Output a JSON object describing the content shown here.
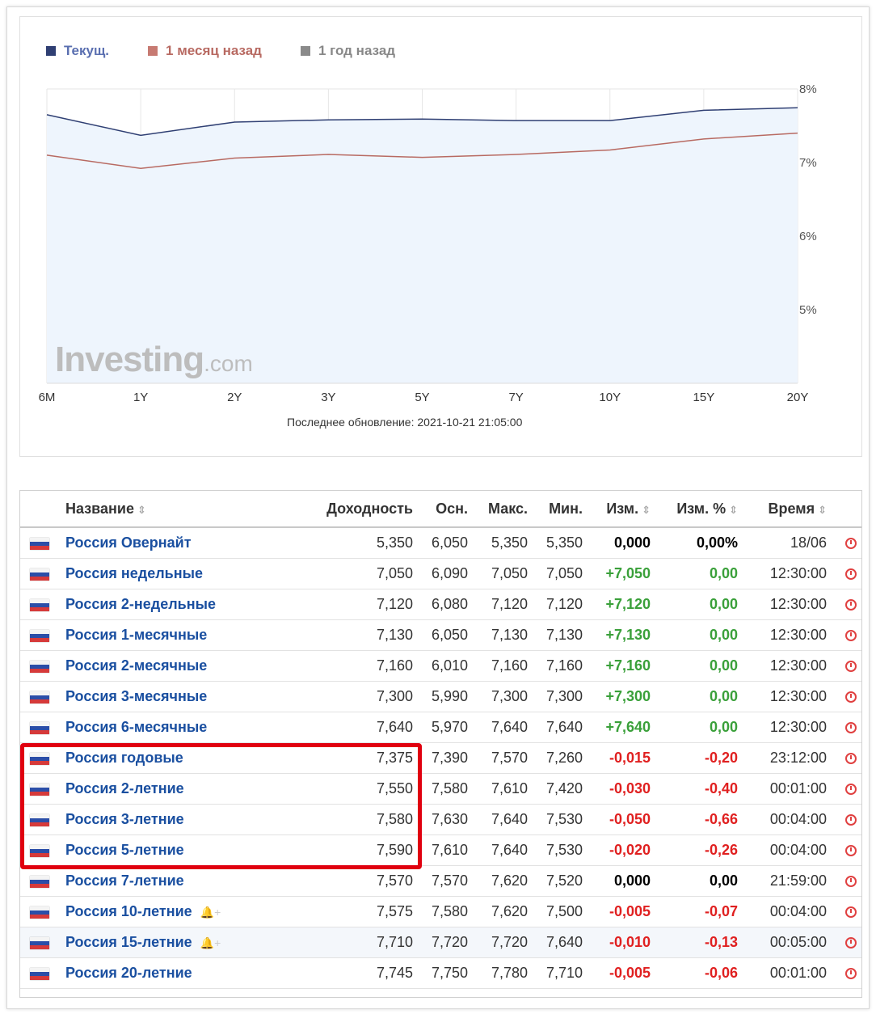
{
  "chart_data": {
    "type": "line",
    "title": "",
    "categories": [
      "6M",
      "1Y",
      "2Y",
      "3Y",
      "5Y",
      "7Y",
      "10Y",
      "15Y",
      "20Y"
    ],
    "series": [
      {
        "name": "Текущ.",
        "color": "#2f3f73",
        "values": [
          7.65,
          7.37,
          7.55,
          7.58,
          7.59,
          7.57,
          7.57,
          7.71,
          7.745
        ]
      },
      {
        "name": "1 месяц назад",
        "color": "#b86a62",
        "values": [
          7.1,
          6.92,
          7.06,
          7.11,
          7.07,
          7.11,
          7.17,
          7.32,
          7.4
        ]
      },
      {
        "name": "1 год назад",
        "color": "#8a8a8a",
        "values": []
      }
    ],
    "y_ticks": [
      "8%",
      "7%",
      "6%",
      "5%"
    ],
    "ylim": [
      4.0,
      8.0
    ],
    "grid": true,
    "legend": "top-left",
    "watermark": "Investing",
    "watermark_suffix": ".com",
    "update_note": "Последнее обновление: 2021-10-21 21:05:00"
  },
  "table": {
    "headers": {
      "name": "Название",
      "yield": "Доходность",
      "prev": "Осн.",
      "high": "Макс.",
      "low": "Мин.",
      "chg": "Изм.",
      "chg_pct": "Изм. %",
      "time": "Время"
    },
    "rows": [
      {
        "name": "Россия Овернайт",
        "yield": "5,350",
        "prev": "6,050",
        "high": "5,350",
        "low": "5,350",
        "chg": "0,000",
        "chg_pct": "0,00%",
        "time": "18/06",
        "dir": "zero"
      },
      {
        "name": "Россия недельные",
        "yield": "7,050",
        "prev": "6,090",
        "high": "7,050",
        "low": "7,050",
        "chg": "+7,050",
        "chg_pct": "0,00",
        "time": "12:30:00",
        "dir": "pos"
      },
      {
        "name": "Россия 2-недельные",
        "yield": "7,120",
        "prev": "6,080",
        "high": "7,120",
        "low": "7,120",
        "chg": "+7,120",
        "chg_pct": "0,00",
        "time": "12:30:00",
        "dir": "pos"
      },
      {
        "name": "Россия 1-месячные",
        "yield": "7,130",
        "prev": "6,050",
        "high": "7,130",
        "low": "7,130",
        "chg": "+7,130",
        "chg_pct": "0,00",
        "time": "12:30:00",
        "dir": "pos"
      },
      {
        "name": "Россия 2-месячные",
        "yield": "7,160",
        "prev": "6,010",
        "high": "7,160",
        "low": "7,160",
        "chg": "+7,160",
        "chg_pct": "0,00",
        "time": "12:30:00",
        "dir": "pos"
      },
      {
        "name": "Россия 3-месячные",
        "yield": "7,300",
        "prev": "5,990",
        "high": "7,300",
        "low": "7,300",
        "chg": "+7,300",
        "chg_pct": "0,00",
        "time": "12:30:00",
        "dir": "pos"
      },
      {
        "name": "Россия 6-месячные",
        "yield": "7,640",
        "prev": "5,970",
        "high": "7,640",
        "low": "7,640",
        "chg": "+7,640",
        "chg_pct": "0,00",
        "time": "12:30:00",
        "dir": "pos"
      },
      {
        "name": "Россия годовые",
        "yield": "7,375",
        "prev": "7,390",
        "high": "7,570",
        "low": "7,260",
        "chg": "-0,015",
        "chg_pct": "-0,20",
        "time": "23:12:00",
        "dir": "neg"
      },
      {
        "name": "Россия 2-летние",
        "yield": "7,550",
        "prev": "7,580",
        "high": "7,610",
        "low": "7,420",
        "chg": "-0,030",
        "chg_pct": "-0,40",
        "time": "00:01:00",
        "dir": "neg"
      },
      {
        "name": "Россия 3-летние",
        "yield": "7,580",
        "prev": "7,630",
        "high": "7,640",
        "low": "7,530",
        "chg": "-0,050",
        "chg_pct": "-0,66",
        "time": "00:04:00",
        "dir": "neg"
      },
      {
        "name": "Россия 5-летние",
        "yield": "7,590",
        "prev": "7,610",
        "high": "7,640",
        "low": "7,530",
        "chg": "-0,020",
        "chg_pct": "-0,26",
        "time": "00:04:00",
        "dir": "neg"
      },
      {
        "name": "Россия 7-летние",
        "yield": "7,570",
        "prev": "7,570",
        "high": "7,620",
        "low": "7,520",
        "chg": "0,000",
        "chg_pct": "0,00",
        "time": "21:59:00",
        "dir": "zero"
      },
      {
        "name": "Россия 10-летние",
        "yield": "7,575",
        "prev": "7,580",
        "high": "7,620",
        "low": "7,500",
        "chg": "-0,005",
        "chg_pct": "-0,07",
        "time": "00:04:00",
        "dir": "neg",
        "bell": true
      },
      {
        "name": "Россия 15-летние",
        "yield": "7,710",
        "prev": "7,720",
        "high": "7,720",
        "low": "7,640",
        "chg": "-0,010",
        "chg_pct": "-0,13",
        "time": "00:05:00",
        "dir": "neg",
        "bell": true,
        "alt": true
      },
      {
        "name": "Россия 20-летние",
        "yield": "7,745",
        "prev": "7,750",
        "high": "7,780",
        "low": "7,710",
        "chg": "-0,005",
        "chg_pct": "-0,06",
        "time": "00:01:00",
        "dir": "neg"
      }
    ]
  },
  "icons": {
    "flag": "russia-flag-icon",
    "clock": "clock-icon",
    "sort": "sort-icon",
    "bell": "add-alert-bell-icon"
  }
}
